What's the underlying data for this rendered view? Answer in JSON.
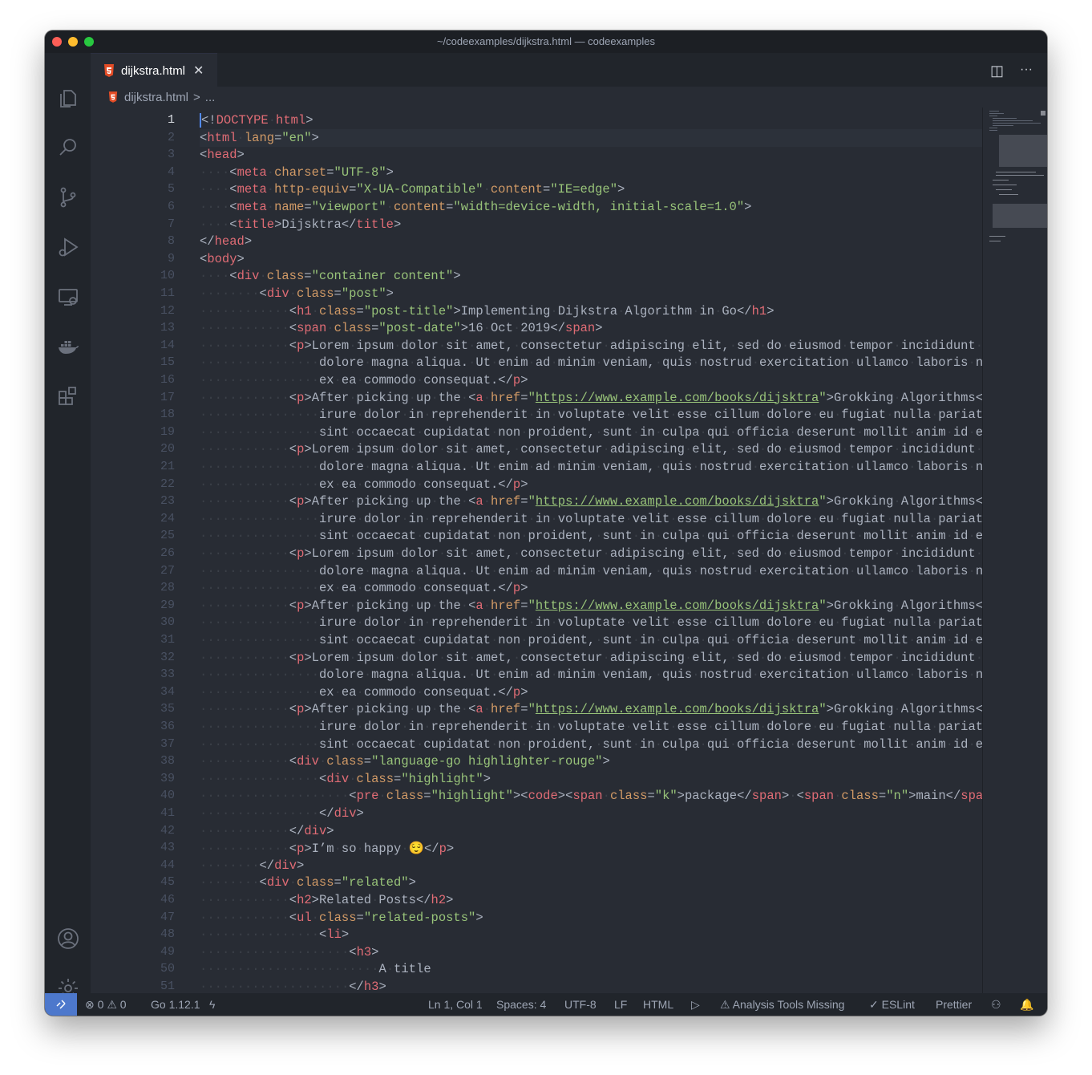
{
  "window": {
    "title": "~/codeexamples/dijkstra.html — codeexamples"
  },
  "activity_bar": [
    "files-icon",
    "search-icon",
    "source-control-icon",
    "run-debug-icon",
    "remote-explorer-icon",
    "docker-icon",
    "extensions-icon",
    "account-icon",
    "settings-gear-icon"
  ],
  "tab": {
    "label": "dijkstra.html",
    "close": "✕"
  },
  "tab_actions": {
    "split": "◫",
    "more": "···"
  },
  "breadcrumb": {
    "file": "dijkstra.html",
    "sep": ">",
    "rest": "..."
  },
  "editor": {
    "active_line": 1,
    "lines": [
      "<!DOCTYPE html>",
      "<html lang=\"en\">",
      "<head>",
      "    <meta charset=\"UTF-8\">",
      "    <meta http-equiv=\"X-UA-Compatible\" content=\"IE=edge\">",
      "    <meta name=\"viewport\" content=\"width=device-width, initial-scale=1.0\">",
      "    <title>Dijsktra</title>",
      "</head>",
      "<body>",
      "    <div class=\"container content\">",
      "        <div class=\"post\">",
      "            <h1 class=\"post-title\">Implementing Dijkstra Algorithm in Go</h1>",
      "            <span class=\"post-date\">16 Oct 2019</span>",
      "            <p>Lorem ipsum dolor sit amet, consectetur adipiscing elit, sed do eiusmod tempor incididunt ut lal",
      "                dolore magna aliqua. Ut enim ad minim veniam, quis nostrud exercitation ullamco laboris nisi ut",
      "                ex ea commodo consequat.</p>",
      "            <p>After picking up the <a href=\"https://www.example.com/books/dijsktra\">Grokking Algorithms</a> Du",
      "                irure dolor in reprehenderit in voluptate velit esse cillum dolore eu fugiat nulla pariatur. Ex",
      "                sint occaecat cupidatat non proident, sunt in culpa qui officia deserunt mollit anim id est lal",
      "            <p>Lorem ipsum dolor sit amet, consectetur adipiscing elit, sed do eiusmod tempor incididunt ut lal",
      "                dolore magna aliqua. Ut enim ad minim veniam, quis nostrud exercitation ullamco laboris nisi ut",
      "                ex ea commodo consequat.</p>",
      "            <p>After picking up the <a href=\"https://www.example.com/books/dijsktra\">Grokking Algorithms</a> Du",
      "                irure dolor in reprehenderit in voluptate velit esse cillum dolore eu fugiat nulla pariatur. Ex",
      "                sint occaecat cupidatat non proident, sunt in culpa qui officia deserunt mollit anim id est lal",
      "            <p>Lorem ipsum dolor sit amet, consectetur adipiscing elit, sed do eiusmod tempor incididunt ut lal",
      "                dolore magna aliqua. Ut enim ad minim veniam, quis nostrud exercitation ullamco laboris nisi ut",
      "                ex ea commodo consequat.</p>",
      "            <p>After picking up the <a href=\"https://www.example.com/books/dijsktra\">Grokking Algorithms</a> Du",
      "                irure dolor in reprehenderit in voluptate velit esse cillum dolore eu fugiat nulla pariatur. Ex",
      "                sint occaecat cupidatat non proident, sunt in culpa qui officia deserunt mollit anim id est lal",
      "            <p>Lorem ipsum dolor sit amet, consectetur adipiscing elit, sed do eiusmod tempor incididunt ut lal",
      "                dolore magna aliqua. Ut enim ad minim veniam, quis nostrud exercitation ullamco laboris nisi ut",
      "                ex ea commodo consequat.</p>",
      "            <p>After picking up the <a href=\"https://www.example.com/books/dijsktra\">Grokking Algorithms</a> Du",
      "                irure dolor in reprehenderit in voluptate velit esse cillum dolore eu fugiat nulla pariatur. Ex",
      "                sint occaecat cupidatat non proident, sunt in culpa qui officia deserunt mollit anim id est lal",
      "            <div class=\"language-go highlighter-rouge\">",
      "                <div class=\"highlight\">",
      "                    <pre class=\"highlight\"><code><span class=\"k\">package</span> <span class=\"n\">main</span>",
      "                </div>",
      "            </div>",
      "            <p>I’m so happy 😌</p>",
      "        </div>",
      "        <div class=\"related\">",
      "            <h2>Related Posts</h2>",
      "            <ul class=\"related-posts\">",
      "                <li>",
      "                    <h3>",
      "                        A title",
      "                    </h3>"
    ]
  },
  "status_bar": {
    "errors": "0",
    "warnings": "0",
    "go_version": "Go 1.12.1",
    "position": "Ln 1, Col 1",
    "spaces": "Spaces: 4",
    "encoding": "UTF-8",
    "eol": "LF",
    "language": "HTML",
    "analysis": "Analysis Tools Missing",
    "eslint": "ESLint",
    "prettier": "Prettier"
  },
  "colors": {
    "accent": "#4d78cc",
    "tag": "#e06c75",
    "attribute": "#d19a66",
    "string": "#98c379",
    "text": "#abb2bf",
    "background": "#282c34"
  }
}
